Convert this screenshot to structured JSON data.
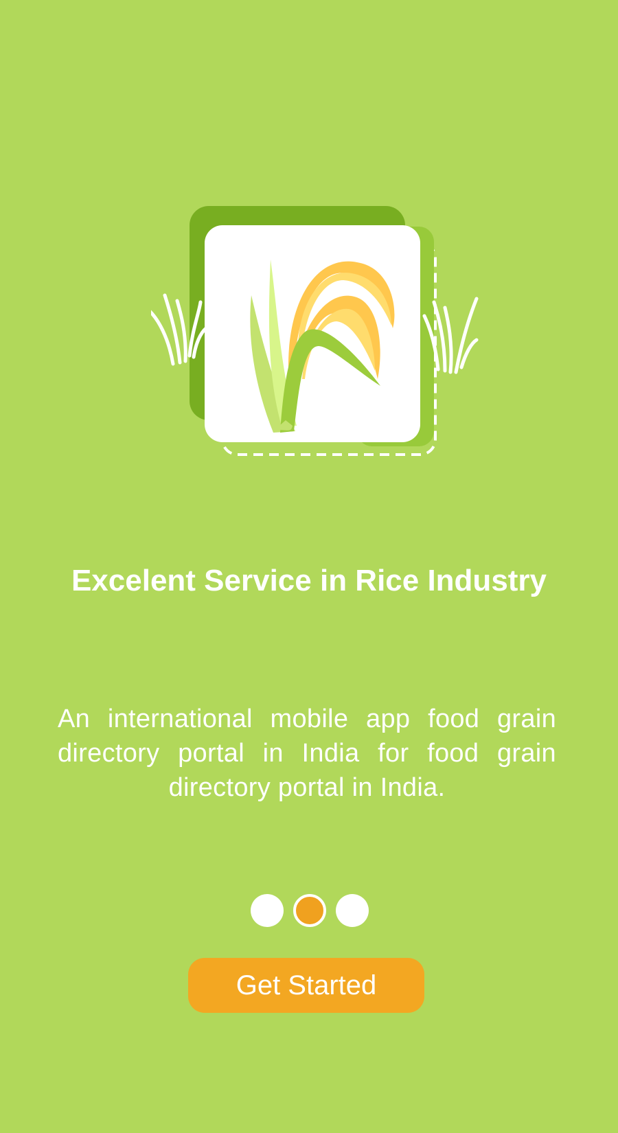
{
  "onboarding": {
    "logo_icon": "rice-plant-icon",
    "title": "Excelent Service in Rice Industry",
    "description": "An international mobile app food grain directory portal in India for  food grain directory portal in India.",
    "pager": {
      "total": 3,
      "active_index": 1
    },
    "get_started_label": "Get Started"
  },
  "colors": {
    "background": "#b1d85a",
    "logo_back_card": "#78ae21",
    "accent": "#f3a722",
    "text": "#ffffff"
  }
}
